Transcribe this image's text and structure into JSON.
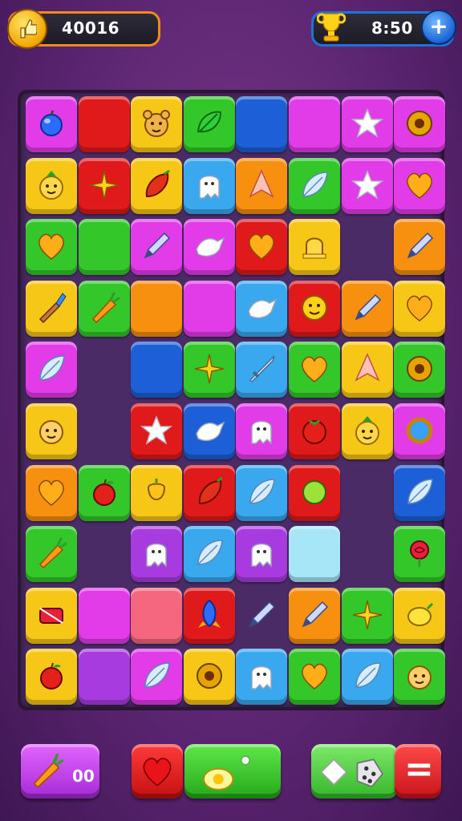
{
  "hud": {
    "score": "40016",
    "timer": "8:50",
    "add_label": "+"
  },
  "bottom_bar": {
    "booster_count": "00",
    "swap_label": "="
  },
  "colors": {
    "magenta": "#e13ce8",
    "red": "#e01a1a",
    "yellow": "#f7c718",
    "green": "#33c72a",
    "blue": "#1d5fd6",
    "orange": "#f7900e",
    "sky": "#3aa8ee",
    "purple": "#a83be0",
    "pink": "#f5677f",
    "pale": "#a7e6f7"
  },
  "board": {
    "rows": 10,
    "cols": 8,
    "tiles": [
      [
        "magenta:blueberry-icon",
        "red:none",
        "yellow:bear-face-icon",
        "green:leaf-icon",
        "blue:none",
        "magenta:none",
        "magenta:star-icon",
        "magenta:donut-icon"
      ],
      [
        "yellow:pineapple-face-icon",
        "red:sparkle-icon",
        "yellow:chili-icon",
        "sky:ghost-icon",
        "orange:arrow-icon",
        "green:feather-icon",
        "magenta:star-icon",
        "magenta:heart-icon"
      ],
      [
        "green:heart-icon",
        "green:none",
        "magenta:pencil-icon",
        "magenta:bird-icon",
        "red:heart-icon",
        "yellow:bell-icon",
        "empty",
        "orange:pencil-icon"
      ],
      [
        "yellow:brush-icon",
        "green:carrot-icon",
        "orange:none",
        "magenta:none",
        "sky:bird-icon",
        "red:smiley-icon",
        "orange:pencil-icon",
        "yellow:heart-icon"
      ],
      [
        "magenta:feather-icon",
        "empty",
        "blue:none",
        "green:sparkle-icon",
        "sky:sword-icon",
        "green:heart-icon",
        "yellow:arrow-icon",
        "green:donut-icon"
      ],
      [
        "yellow:face-icon",
        "empty",
        "red:star-icon",
        "blue:bird-icon",
        "magenta:ghost-icon",
        "red:tomato-icon",
        "yellow:pineapple-face-icon",
        "magenta:ring-icon"
      ],
      [
        "orange:heart-icon",
        "green:apple-icon",
        "yellow:pepper-icon",
        "red:chili-icon",
        "sky:feather-icon",
        "red:lime-icon",
        "empty",
        "blue:feather-icon"
      ],
      [
        "green:carrot-icon",
        "empty",
        "purple:ghost-icon",
        "sky:feather-icon",
        "purple:ghost-icon",
        "pale:none",
        "empty",
        "green:rose-icon"
      ],
      [
        "yellow:candy-icon",
        "magenta:none",
        "pink:none",
        "red:rocket-icon",
        "empty:pencil-icon",
        "orange:pencil-icon",
        "green:sparkle-icon",
        "yellow:lemon-icon"
      ],
      [
        "yellow:apple-icon",
        "purple:none",
        "magenta:feather-icon",
        "yellow:donut-icon",
        "sky:ghost-icon",
        "green:heart-icon",
        "sky:feather-icon",
        "green:face-icon"
      ]
    ]
  }
}
